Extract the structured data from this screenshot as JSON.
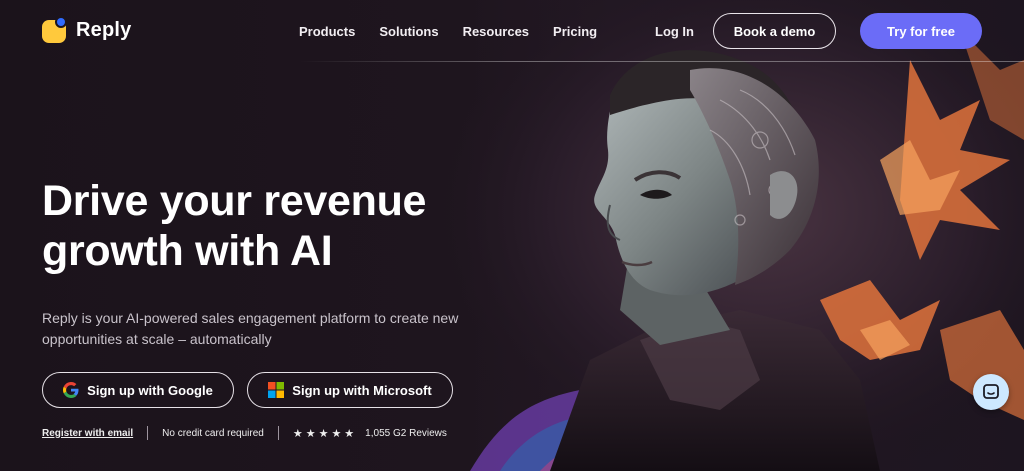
{
  "header": {
    "brand": "Reply",
    "nav": [
      "Products",
      "Solutions",
      "Resources",
      "Pricing"
    ],
    "login": "Log In",
    "demo": "Book a demo",
    "try": "Try for free"
  },
  "hero": {
    "headline_line1": "Drive your revenue",
    "headline_line2": "growth with AI",
    "sub_line1": "Reply is your AI-powered sales engagement platform to create new",
    "sub_line2": "opportunities at scale – automatically",
    "google_btn": "Sign up with Google",
    "ms_btn": "Sign up with Microsoft",
    "register": "Register with email",
    "no_card": "No credit card required",
    "stars": "★★★★★",
    "reviews": "1,055 G2 Reviews"
  },
  "icons": {
    "logo": "reply-logo-icon",
    "google": "google-icon",
    "microsoft": "microsoft-icon",
    "chat": "chat-icon"
  },
  "colors": {
    "accent": "#6b6cf7",
    "logo_yellow": "#ffc93c",
    "logo_blue": "#2f6bff",
    "background": "#1c141c"
  }
}
